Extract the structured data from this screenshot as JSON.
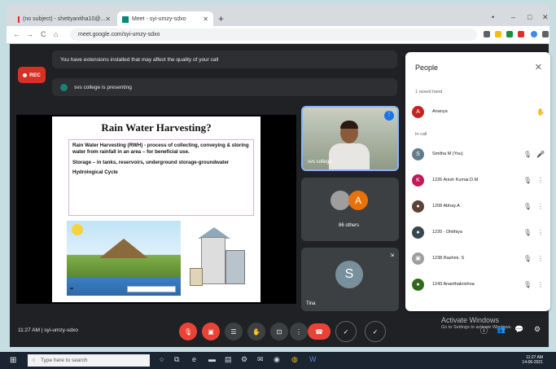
{
  "browser": {
    "tabs": [
      {
        "label": "(no subject) - shettyanitha10@...",
        "active": false
      },
      {
        "label": "Meet - syi-umzy-sdxo",
        "active": true
      }
    ],
    "new_tab": "+",
    "window_controls": [
      "•",
      "–",
      "□",
      "✕"
    ],
    "url": "meet.google.com/syi-umzy-sdxo",
    "nav": [
      "←",
      "→",
      "C",
      "⌂"
    ]
  },
  "meet": {
    "rec_label": "REC",
    "warning": "You have extensions installed that may affect the quality of your call",
    "presenting": "svs college is presenting",
    "slide": {
      "title": "Rain Water Harvesting?",
      "definition": "Rain Water Harvesting (RWH) - process of collecting, conveying & storing water from rainfall in an area – for beneficial use.",
      "storage": "Storage – in tanks, reservoirs, underground storage-groundwater",
      "cycle": "Hydrological Cycle"
    },
    "tiles": {
      "self_label": "svs college",
      "self_menu": "⋮",
      "others_label": "86 others",
      "others_avatar": "A",
      "tina_label": "Tina",
      "tina_avatar": "S"
    },
    "time": "11:27 AM",
    "meeting_code": "syi-umzy-sdxo"
  },
  "people": {
    "title": "People",
    "close": "✕",
    "raised_hand_section": "1 raised hand",
    "in_call_section": "In call",
    "raised": [
      {
        "name": "Ananya",
        "initial": "A",
        "color": "#c5221f"
      }
    ],
    "in_call": [
      {
        "name": "Smitha M (You)",
        "initial": "S",
        "color": "#607d8b"
      },
      {
        "name": "1226 Anish Kumar.D.M",
        "initial": "K",
        "color": "#c2185b"
      },
      {
        "name": "1208 Abhay.A",
        "initial": "●",
        "color": "#5d4037"
      },
      {
        "name": "1220 - Dhithiya",
        "initial": "●",
        "color": "#37474f"
      },
      {
        "name": "1238 Rashmi. S",
        "initial": "▣",
        "color": "#9e9e9e"
      },
      {
        "name": "1243 Ananthakrishna",
        "initial": "●",
        "color": "#33691e"
      }
    ]
  },
  "overlay": {
    "activate_title": "Activate Windows",
    "activate_sub": "Go to Settings to activate Windows."
  },
  "taskbar": {
    "search_placeholder": "Type here to search",
    "clock_time": "11:27 AM",
    "clock_date": "14-06-2021"
  }
}
